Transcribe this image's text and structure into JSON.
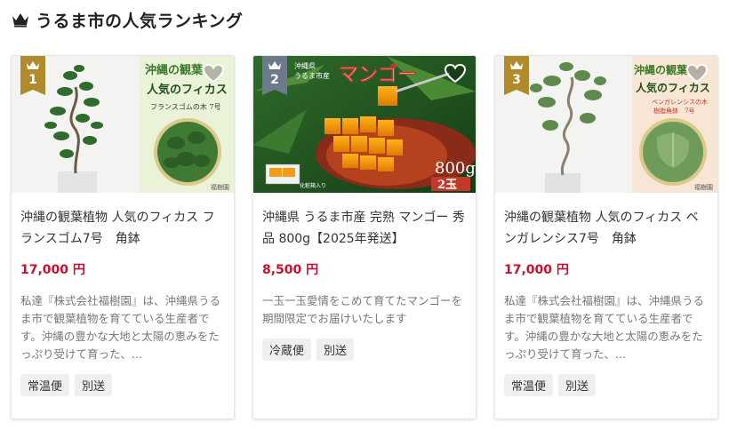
{
  "header": {
    "title": "うるま市の人気ランキング",
    "icon": "crown-icon"
  },
  "colors": {
    "price": "#c8102e",
    "rank1": "#b08a2b",
    "rank2": "#6c7a8c",
    "rank3": "#b08a2b"
  },
  "cards": [
    {
      "rank": "1",
      "name": "沖縄の観葉植物 人気のフィカス フランスゴム7号　角鉢",
      "price": "17,000 円",
      "description": "私達『株式会社福樹園』は、沖縄県うるま市で観葉植物を育てている生産者です。沖縄の豊かな大地と太陽の恵みをたっぷり受けて育った、...",
      "tags": [
        "常温便",
        "別送"
      ],
      "image_text": {
        "line1": "沖縄の観葉",
        "line2": "人気のフィカス",
        "line3": "フランスゴムの木 7号",
        "logo": "福樹園"
      }
    },
    {
      "rank": "2",
      "name": "沖縄県 うるま市産 完熟 マンゴー 秀品 800g【2025年発送】",
      "price": "8,500 円",
      "description": "一玉一玉愛情をこめて育てたマンゴーを期間限定でお届けいたします",
      "tags": [
        "冷蔵便",
        "別送"
      ],
      "image_text": {
        "origin1": "沖縄県",
        "origin2": "うるま市産",
        "title": "マンゴー",
        "weight": "800g",
        "count": "2玉",
        "box": "化粧箱入り"
      }
    },
    {
      "rank": "3",
      "name": "沖縄の観葉植物 人気のフィカス ベンガレンシス7号　角鉢",
      "price": "17,000 円",
      "description": "私達『株式会社福樹園』は、沖縄県うるま市で観葉植物を育てている生産者です。沖縄の豊かな大地と太陽の恵みをたっぷり受けて育った、...",
      "tags": [
        "常温便",
        "別送"
      ],
      "image_text": {
        "line1": "沖縄の観葉",
        "line2": "人気のフィカス",
        "line3": "ベンガレンシスの木",
        "line4": "樹脂角鉢　7号",
        "logo": "福樹園"
      }
    }
  ]
}
